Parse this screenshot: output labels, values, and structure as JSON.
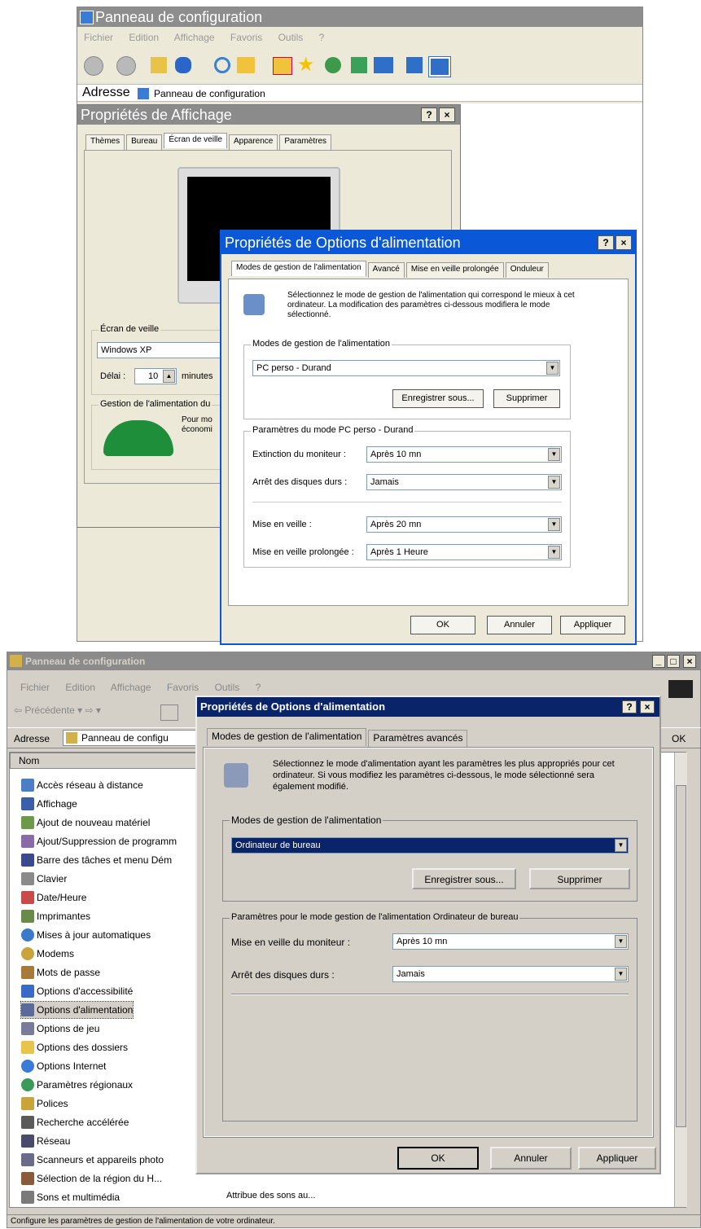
{
  "top": {
    "window_title": "Panneau de configuration",
    "menu": [
      "Fichier",
      "Edition",
      "Affichage",
      "Favoris",
      "Outils",
      "?"
    ],
    "address_label": "Adresse",
    "address_value": "Panneau de configuration",
    "display_dialog": {
      "title": "Propriétés de Affichage",
      "help": "?",
      "close": "×",
      "tabs": [
        "Thèmes",
        "Bureau",
        "Écran de veille",
        "Apparence",
        "Paramètres"
      ],
      "screensaver_group": "Écran de veille",
      "screensaver_value": "Windows XP",
      "delay_label": "Délai :",
      "delay_value": "10",
      "minutes_label": "minutes",
      "power_group": "Gestion de l'alimentation du",
      "power_text1": "Pour mo",
      "power_text2": "économi"
    },
    "power_dialog": {
      "title": "Propriétés de Options d'alimentation",
      "help": "?",
      "close": "×",
      "tabs": [
        "Modes de gestion de l'alimentation",
        "Avancé",
        "Mise en veille prolongée",
        "Onduleur"
      ],
      "description": "Sélectionnez le mode de gestion de l'alimentation qui correspond le mieux à cet ordinateur. La modification des paramètres ci-dessous modifiera le mode sélectionné.",
      "schemes_group": "Modes de gestion de l'alimentation",
      "scheme_value": "PC perso - Durand",
      "save_as": "Enregistrer sous...",
      "delete": "Supprimer",
      "settings_group": "Paramètres du mode PC perso - Durand",
      "rows": [
        {
          "label": "Extinction du moniteur :",
          "value": "Après 10 mn"
        },
        {
          "label": "Arrêt des disques durs :",
          "value": "Jamais"
        },
        {
          "label": "Mise en veille :",
          "value": "Après 20 mn"
        },
        {
          "label": "Mise en veille prolongée :",
          "value": "Après 1 Heure"
        }
      ],
      "ok": "OK",
      "cancel": "Annuler",
      "apply": "Appliquer"
    }
  },
  "bottom": {
    "window_title": "Panneau de configuration",
    "menu": [
      "Fichier",
      "Edition",
      "Affichage",
      "Favoris",
      "Outils",
      "?"
    ],
    "back_label": "Précédente",
    "address_label": "Adresse",
    "address_value": "Panneau de configu",
    "go_label": "OK",
    "col_name": "Nom",
    "items": [
      "Accès réseau à distance",
      "Affichage",
      "Ajout de nouveau matériel",
      "Ajout/Suppression de programm",
      "Barre des tâches et menu Dém",
      "Clavier",
      "Date/Heure",
      "Imprimantes",
      "Mises à jour automatiques",
      "Modems",
      "Mots de passe",
      "Options d'accessibilité",
      "Options d'alimentation",
      "Options de jeu",
      "Options des dossiers",
      "Options Internet",
      "Paramètres régionaux",
      "Polices",
      "Recherche accélérée",
      "Réseau",
      "Scanneurs et appareils photo",
      "Sélection de la région du H...",
      "Sons et multimédia"
    ],
    "sound_desc": "Attribue des sons au...",
    "status_text": "Configure les paramètres de gestion de l'alimentation de votre ordinateur.",
    "dialog": {
      "title": "Propriétés de Options d'alimentation",
      "help": "?",
      "close": "×",
      "tabs": [
        "Modes de gestion de l'alimentation",
        "Paramètres avancés"
      ],
      "description": "Sélectionnez le mode d'alimentation ayant les paramètres les plus appropriés pour cet ordinateur. Si vous modifiez les paramètres ci-dessous, le mode sélectionné sera également modifié.",
      "schemes_group": "Modes de gestion de l'alimentation",
      "scheme_value": "Ordinateur de bureau",
      "save_as": "Enregistrer sous...",
      "delete": "Supprimer",
      "settings_group": "Paramètres pour le mode gestion de l'alimentation Ordinateur de bureau",
      "rows": [
        {
          "label": "Mise en veille du moniteur :",
          "value": "Après 10 mn"
        },
        {
          "label": "Arrêt des disques durs :",
          "value": "Jamais"
        }
      ],
      "ok": "OK",
      "cancel": "Annuler",
      "apply": "Appliquer"
    }
  },
  "colors": {
    "xp_title_blue": "#0a58d8",
    "inactive_gray": "#8b8b8b",
    "classic_navy": "#0a246a",
    "selection_blue": "#0a246a"
  }
}
